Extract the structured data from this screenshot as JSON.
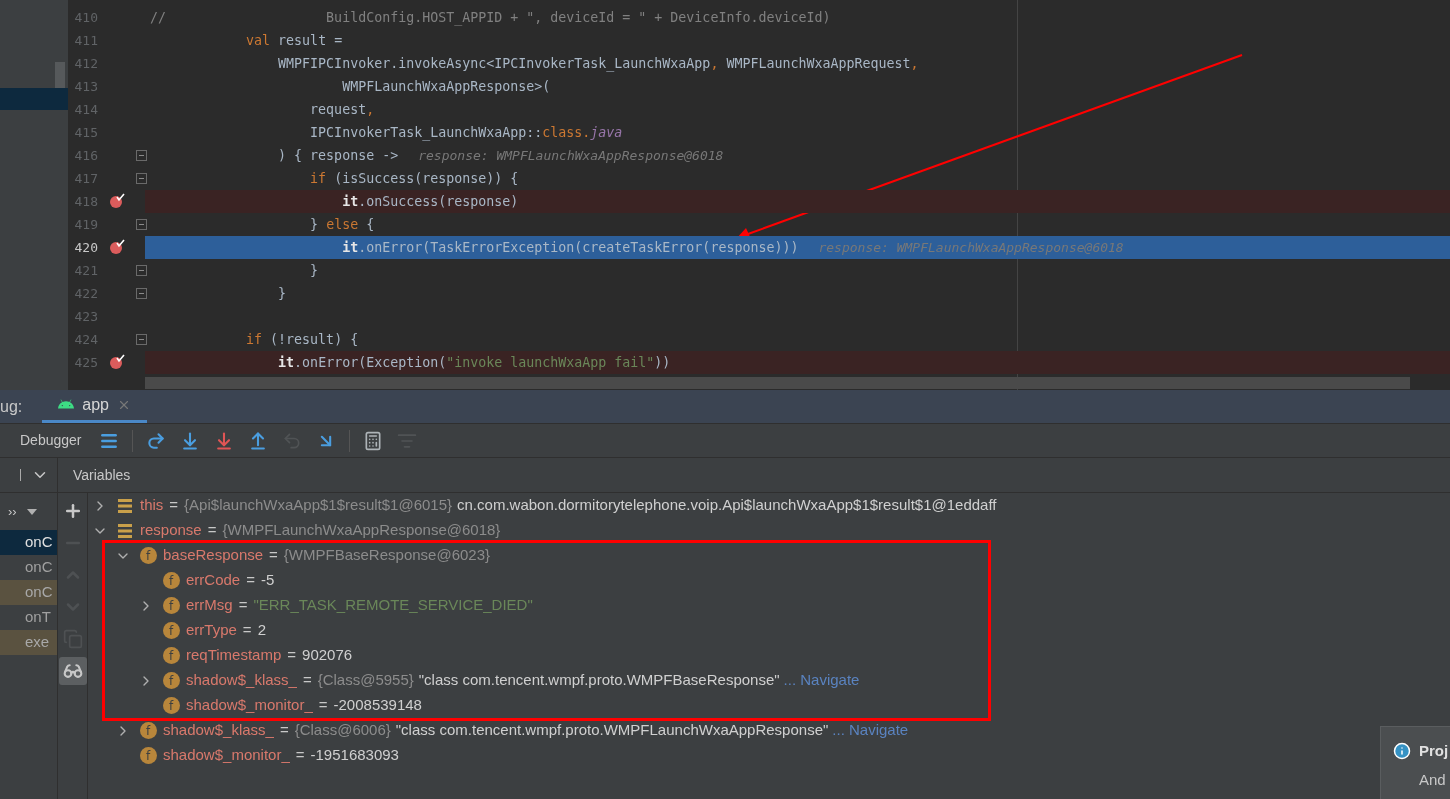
{
  "editor": {
    "lines": [
      {
        "number": "410",
        "fold": false,
        "breakpoint": false,
        "current": false,
        "code": [
          {
            "kind": "comment",
            "text": "//                    BuildConfig.HOST_APPID + \", deviceId = \" + DeviceInfo.deviceId)"
          }
        ]
      },
      {
        "number": "411",
        "fold": false,
        "breakpoint": false,
        "current": false,
        "code": [
          {
            "kind": "keyword",
            "text": "            val"
          },
          {
            "kind": "plain",
            "text": " result ="
          }
        ]
      },
      {
        "number": "412",
        "fold": false,
        "breakpoint": false,
        "current": false,
        "code": [
          {
            "kind": "plain",
            "text": "                WMPFIPCInvoker.invokeAsync<IPCInvokerTask_LaunchWxaApp"
          },
          {
            "kind": "keyword",
            "text": ","
          },
          {
            "kind": "plain",
            "text": " WMPFLaunchWxaAppRequest"
          },
          {
            "kind": "keyword",
            "text": ","
          }
        ]
      },
      {
        "number": "413",
        "fold": false,
        "breakpoint": false,
        "current": false,
        "code": [
          {
            "kind": "plain",
            "text": "                        WMPFLaunchWxaAppResponse>("
          }
        ]
      },
      {
        "number": "414",
        "fold": false,
        "breakpoint": false,
        "current": false,
        "code": [
          {
            "kind": "plain",
            "text": "                    request"
          },
          {
            "kind": "keyword",
            "text": ","
          }
        ]
      },
      {
        "number": "415",
        "fold": false,
        "breakpoint": false,
        "current": false,
        "code": [
          {
            "kind": "plain",
            "text": "                    IPCInvokerTask_LaunchWxaApp::"
          },
          {
            "kind": "keyword",
            "text": "class."
          },
          {
            "kind": "italic",
            "text": "java"
          }
        ]
      },
      {
        "number": "416",
        "fold": true,
        "breakpoint": false,
        "current": false,
        "code": [
          {
            "kind": "plain",
            "text": "                ) { response ->"
          }
        ],
        "hint": "response: WMPFLaunchWxaAppResponse@6018"
      },
      {
        "number": "417",
        "fold": true,
        "breakpoint": false,
        "current": false,
        "code": [
          {
            "kind": "keyword",
            "text": "                    if"
          },
          {
            "kind": "plain",
            "text": " (isSuccess(response)) {"
          }
        ]
      },
      {
        "number": "418",
        "fold": false,
        "breakpoint": true,
        "current": false,
        "code": [
          {
            "kind": "bold",
            "text": "                        it"
          },
          {
            "kind": "plain",
            "text": ".onSuccess(response)"
          }
        ]
      },
      {
        "number": "419",
        "fold": true,
        "breakpoint": false,
        "current": false,
        "code": [
          {
            "kind": "plain",
            "text": "                    } "
          },
          {
            "kind": "keyword",
            "text": "else"
          },
          {
            "kind": "plain",
            "text": " {"
          }
        ]
      },
      {
        "number": "420",
        "fold": false,
        "breakpoint": true,
        "current": true,
        "code": [
          {
            "kind": "bold",
            "text": "                        it"
          },
          {
            "kind": "plain",
            "text": ".onError(TaskErrorException(createTaskError(response)))"
          }
        ],
        "hint": "response: WMPFLaunchWxaAppResponse@6018"
      },
      {
        "number": "421",
        "fold": true,
        "breakpoint": false,
        "current": false,
        "code": [
          {
            "kind": "plain",
            "text": "                    }"
          }
        ]
      },
      {
        "number": "422",
        "fold": true,
        "breakpoint": false,
        "current": false,
        "code": [
          {
            "kind": "plain",
            "text": "                }"
          }
        ]
      },
      {
        "number": "423",
        "fold": false,
        "breakpoint": false,
        "current": false
      },
      {
        "number": "424",
        "fold": true,
        "breakpoint": false,
        "current": false,
        "code": [
          {
            "kind": "keyword",
            "text": "            if"
          },
          {
            "kind": "plain",
            "text": " (!result) {"
          }
        ]
      },
      {
        "number": "425",
        "fold": false,
        "breakpoint": true,
        "current": false,
        "code": [
          {
            "kind": "bold",
            "text": "                it"
          },
          {
            "kind": "plain",
            "text": ".onError(Exception("
          },
          {
            "kind": "string",
            "text": "\"invoke launchWxaApp fail\""
          },
          {
            "kind": "plain",
            "text": "))"
          }
        ]
      }
    ]
  },
  "debug": {
    "label": "ug:",
    "tabs": [
      {
        "label": "app",
        "selected": true
      }
    ],
    "toolbar_title": "Debugger",
    "toolbar": [
      {
        "kind": "layout",
        "disabled": false
      },
      {
        "kind": "sep"
      },
      {
        "kind": "step_over",
        "disabled": false
      },
      {
        "kind": "step_into",
        "disabled": false
      },
      {
        "kind": "force_step_into",
        "disabled": false
      },
      {
        "kind": "step_out",
        "disabled": false
      },
      {
        "kind": "drop_frame",
        "disabled": true
      },
      {
        "kind": "run_to_cursor",
        "disabled": false
      },
      {
        "kind": "sep"
      },
      {
        "kind": "evaluate",
        "disabled": false
      },
      {
        "kind": "trace",
        "disabled": true
      }
    ],
    "frames_more": "››",
    "frames": [
      {
        "label": "onC",
        "selected": true,
        "library": false
      },
      {
        "label": "onC",
        "selected": false,
        "library": false
      },
      {
        "label": "onC",
        "selected": false,
        "library": true
      },
      {
        "label": "onT",
        "selected": false,
        "library": false
      },
      {
        "label": "exe",
        "selected": false,
        "library": true
      }
    ],
    "variables_title": "Variables",
    "side_toolbar": [
      {
        "kind": "add",
        "disabled": false,
        "selected": false
      },
      {
        "kind": "remove",
        "disabled": true,
        "selected": false
      },
      {
        "kind": "up",
        "disabled": true,
        "selected": false
      },
      {
        "kind": "down",
        "disabled": true,
        "selected": false
      },
      {
        "kind": "copy",
        "disabled": true,
        "selected": false
      },
      {
        "kind": "watches",
        "disabled": false,
        "selected": true
      }
    ],
    "variables": [
      {
        "kind": "variable",
        "name": "this",
        "sep": "=",
        "ref": "{Api$launchWxaApp$1$result$1@6015}",
        "value": "cn.com.wabon.dormitorytelephone.voip.Api$launchWxaApp$1$result$1@1eddaff",
        "string_literal": false,
        "expanded": false
      },
      {
        "kind": "variable",
        "name": "response",
        "sep": "=",
        "ref": "{WMPFLaunchWxaAppResponse@6018}",
        "expanded": true,
        "children": [
          {
            "kind": "field",
            "badge": "f",
            "name": "baseResponse",
            "sep": "=",
            "ref": "{WMPFBaseResponse@6023}",
            "expanded": true,
            "framed": true,
            "children": [
              {
                "kind": "field",
                "badge": "f",
                "name": "errCode",
                "sep": "=",
                "value": "-5",
                "string_literal": false
              },
              {
                "kind": "field",
                "badge": "f",
                "name": "errMsg",
                "sep": "=",
                "value": "\"ERR_TASK_REMOTE_SERVICE_DIED\"",
                "string_literal": true,
                "expanded": false
              },
              {
                "kind": "field",
                "badge": "f",
                "name": "errType",
                "sep": "=",
                "value": "2",
                "string_literal": false
              },
              {
                "kind": "field",
                "badge": "f",
                "name": "reqTimestamp",
                "sep": "=",
                "value": "902076",
                "string_literal": false
              },
              {
                "kind": "field",
                "badge": "f",
                "name": "shadow$_klass_",
                "sep": "=",
                "ref": "{Class@5955}",
                "value": "\"class com.tencent.wmpf.proto.WMPFBaseResponse\"",
                "string_literal": false,
                "link": "... Navigate",
                "expanded": false
              },
              {
                "kind": "field",
                "badge": "f",
                "name": "shadow$_monitor_",
                "sep": "=",
                "value": "-2008539148",
                "string_literal": false
              }
            ]
          },
          {
            "kind": "field",
            "badge": "f",
            "name": "shadow$_klass_",
            "sep": "=",
            "ref": "{Class@6006}",
            "value": "\"class com.tencent.wmpf.proto.WMPFLaunchWxaAppResponse\"",
            "string_literal": false,
            "link": "... Navigate",
            "expanded": false
          },
          {
            "kind": "field",
            "badge": "f",
            "name": "shadow$_monitor_",
            "sep": "=",
            "value": "-1951683093",
            "string_literal": false
          }
        ]
      }
    ]
  },
  "notification": {
    "title": "Proj",
    "body": "And"
  }
}
